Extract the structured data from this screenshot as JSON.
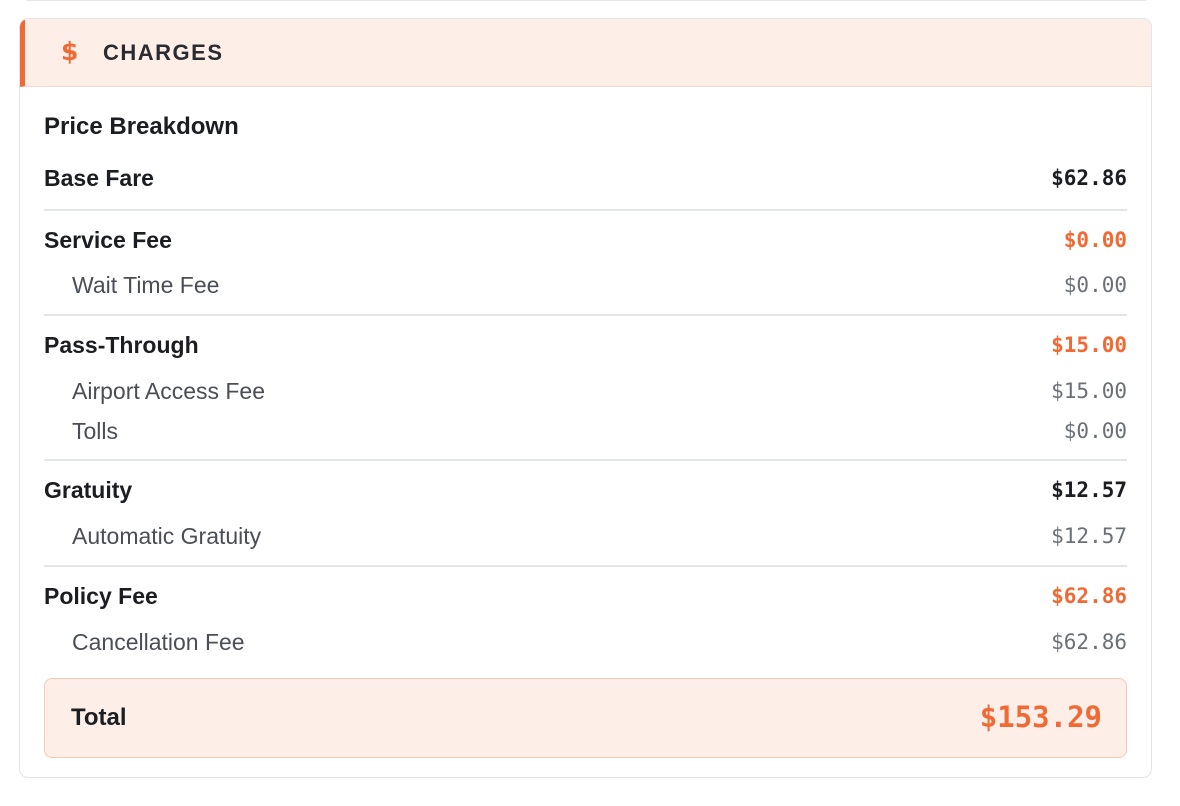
{
  "header": {
    "icon": "dollar-icon",
    "icon_glyph": "$",
    "title": "CHARGES"
  },
  "section_title": "Price Breakdown",
  "groups": [
    {
      "label": "Base Fare",
      "amount": "$62.86",
      "items": []
    },
    {
      "label": "Service Fee",
      "amount": "$0.00",
      "items": [
        {
          "label": "Wait Time Fee",
          "amount": "$0.00"
        }
      ]
    },
    {
      "label": "Pass-Through",
      "amount": "$15.00",
      "items": [
        {
          "label": "Airport Access Fee",
          "amount": "$15.00"
        },
        {
          "label": "Tolls",
          "amount": "$0.00"
        }
      ]
    },
    {
      "label": "Gratuity",
      "amount": "$12.57",
      "items": [
        {
          "label": "Automatic Gratuity",
          "amount": "$12.57"
        }
      ]
    },
    {
      "label": "Policy Fee",
      "amount": "$62.86",
      "items": [
        {
          "label": "Cancellation Fee",
          "amount": "$62.86"
        }
      ]
    }
  ],
  "total": {
    "label": "Total",
    "amount": "$153.29"
  },
  "colors": {
    "accent": "#f06a35",
    "header_bg": "#fdeee8",
    "text": "#1c1d22",
    "muted": "#6b6f78"
  }
}
